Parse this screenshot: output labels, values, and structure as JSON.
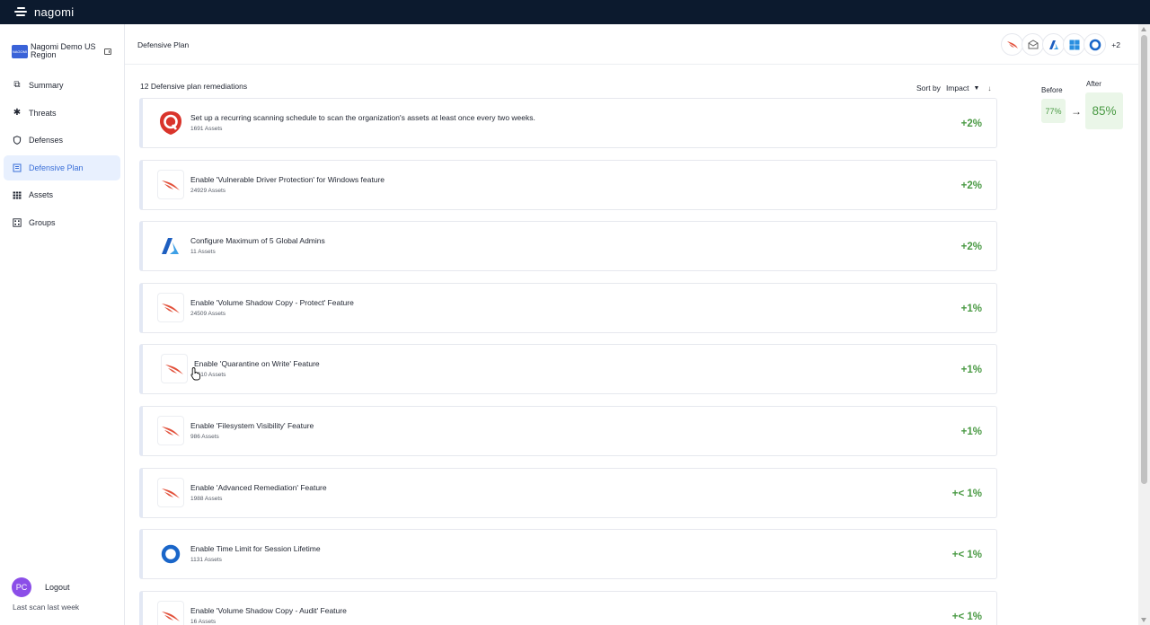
{
  "app": {
    "brand": "nagomi"
  },
  "sidebar": {
    "org_logo_text": "NAGOMI",
    "org_name": "Nagomi Demo US Region",
    "items": [
      {
        "label": "Summary",
        "icon": "summary-icon"
      },
      {
        "label": "Threats",
        "icon": "threats-icon"
      },
      {
        "label": "Defenses",
        "icon": "shield-icon"
      },
      {
        "label": "Defensive Plan",
        "icon": "plan-icon",
        "active": true
      },
      {
        "label": "Assets",
        "icon": "assets-grid-icon"
      },
      {
        "label": "Groups",
        "icon": "groups-icon"
      }
    ],
    "user_initials": "PC",
    "logout_label": "Logout",
    "last_scan": "Last scan last week"
  },
  "header": {
    "title": "Defensive Plan",
    "vendor_icons": [
      "crowdstrike-icon",
      "proofpoint-icon",
      "azure-icon",
      "windows-icon",
      "okta-icon"
    ],
    "more_vendors": "+2"
  },
  "main": {
    "list_title": "12 Defensive plan remediations",
    "sort_label": "Sort by",
    "sort_value": "Impact",
    "remediations": [
      {
        "title": "Set up a recurring scanning schedule to scan the organization's assets at least once every two weeks.",
        "assets": "1691 Assets",
        "impact": "+2%",
        "vendor": "qualys-icon"
      },
      {
        "title": "Enable 'Vulnerable Driver Protection' for Windows feature",
        "assets": "24929 Assets",
        "impact": "+2%",
        "vendor": "crowdstrike-icon"
      },
      {
        "title": "Configure Maximum of 5 Global Admins",
        "assets": "11 Assets",
        "impact": "+2%",
        "vendor": "azure-icon"
      },
      {
        "title": "Enable 'Volume Shadow Copy - Protect' Feature",
        "assets": "24509 Assets",
        "impact": "+1%",
        "vendor": "crowdstrike-icon"
      },
      {
        "title": "Enable 'Quarantine on Write' Feature",
        "assets": "1510 Assets",
        "impact": "+1%",
        "vendor": "crowdstrike-icon"
      },
      {
        "title": "Enable 'Filesystem Visibility' Feature",
        "assets": "986 Assets",
        "impact": "+1%",
        "vendor": "crowdstrike-icon"
      },
      {
        "title": "Enable 'Advanced Remediation' Feature",
        "assets": "1988 Assets",
        "impact": "+< 1%",
        "vendor": "crowdstrike-icon"
      },
      {
        "title": "Enable Time Limit for Session Lifetime",
        "assets": "1131 Assets",
        "impact": "+< 1%",
        "vendor": "okta-icon"
      },
      {
        "title": "Enable 'Volume Shadow Copy - Audit' Feature",
        "assets": "16 Assets",
        "impact": "+< 1%",
        "vendor": "crowdstrike-icon"
      }
    ]
  },
  "score": {
    "before_label": "Before",
    "before_value": "77%",
    "after_label": "After",
    "after_value": "85%"
  },
  "colors": {
    "topbar": "#0c1a2e",
    "accent": "#3a6fd8",
    "impact_green": "#4a9a44",
    "crowdstrike_red": "#e2503a"
  }
}
